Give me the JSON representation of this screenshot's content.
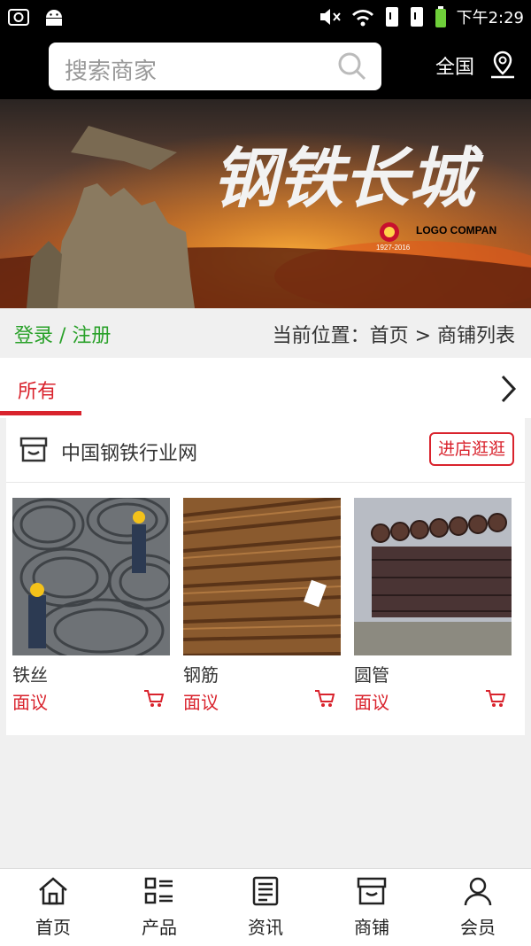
{
  "search": {
    "placeholder": "搜索商家"
  },
  "region": "全国",
  "status": {
    "time": "下午2:29"
  },
  "banner": {
    "title_art": "钢铁长城",
    "logo_text": "LOGO COMPAN",
    "years": "1927-2016"
  },
  "login_register": "登录 / 注册",
  "breadcrumb": "当前位置：首页 > 商铺列表",
  "tab_all": "所有",
  "store": {
    "name": "中国钢铁行业网",
    "visit": "进店逛逛",
    "products": [
      {
        "name": "铁丝",
        "price": "面议"
      },
      {
        "name": "钢筋",
        "price": "面议"
      },
      {
        "name": "圆管",
        "price": "面议"
      }
    ]
  },
  "tabbar": [
    {
      "label": "首页",
      "icon": "home-icon"
    },
    {
      "label": "产品",
      "icon": "list-icon"
    },
    {
      "label": "资讯",
      "icon": "news-icon"
    },
    {
      "label": "商铺",
      "icon": "store-icon"
    },
    {
      "label": "会员",
      "icon": "user-icon"
    }
  ],
  "colors": {
    "accent": "#d9232d",
    "green": "#2aa12a"
  }
}
